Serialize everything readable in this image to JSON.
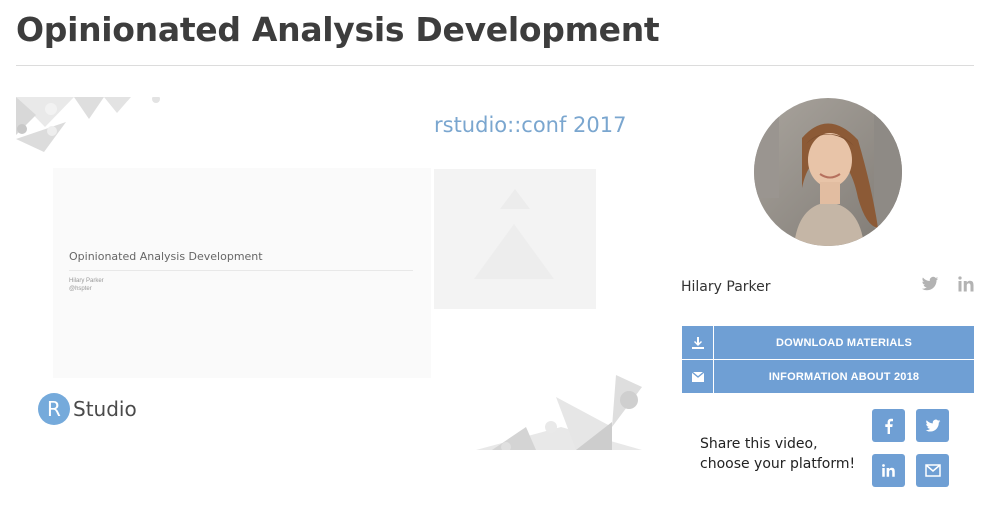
{
  "page": {
    "title": "Opinionated Analysis Development"
  },
  "video": {
    "conference": "rstudio::conf 2017",
    "slide_title": "Opinionated Analysis Development",
    "slide_author": "Hilary Parker",
    "slide_handle": "@hspter",
    "logo_r": "R",
    "logo_text": "Studio"
  },
  "speaker": {
    "name": "Hilary Parker",
    "avatar_icon": "speaker-photo",
    "social": [
      "twitter-icon",
      "linkedin-icon"
    ]
  },
  "actions": [
    {
      "label": "DOWNLOAD MATERIALS",
      "icon": "download-icon"
    },
    {
      "label": "INFORMATION ABOUT 2018",
      "icon": "envelope-icon"
    }
  ],
  "share": {
    "line1": "Share this video,",
    "line2": "choose your platform!",
    "platforms": [
      "facebook-icon",
      "twitter-icon",
      "linkedin-icon",
      "email-icon"
    ]
  },
  "colors": {
    "accent": "#6f9fd4",
    "conf_text": "#7aa6cf",
    "title": "#3d3d3d",
    "icon_grey": "#b3b3b3"
  }
}
